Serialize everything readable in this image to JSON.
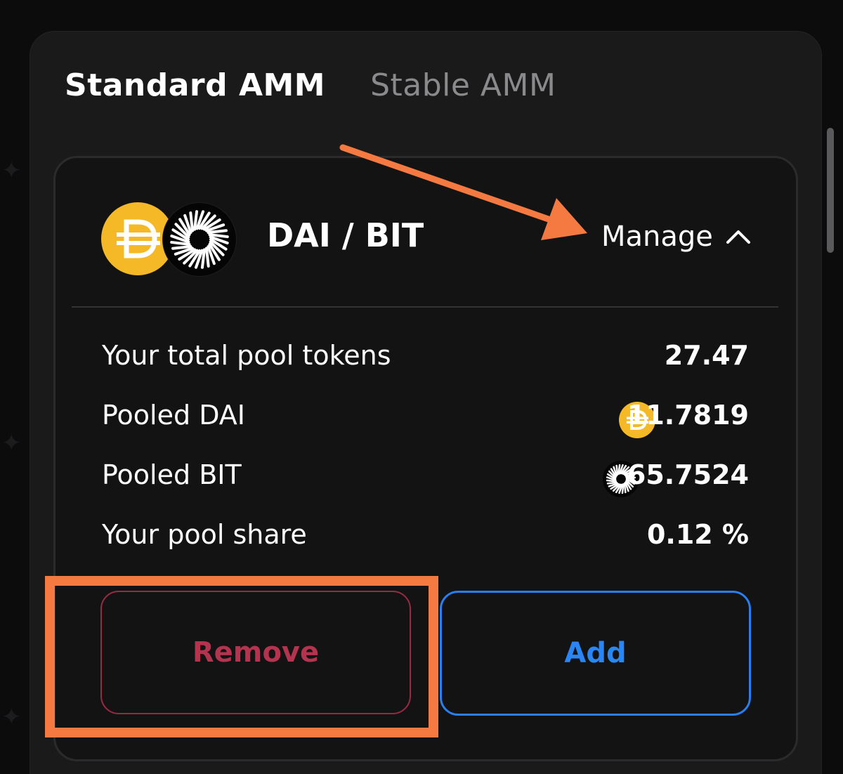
{
  "tabs": [
    {
      "label": "Standard AMM",
      "active": true
    },
    {
      "label": "Stable AMM",
      "active": false
    }
  ],
  "pair": {
    "title": "DAI / BIT",
    "token_a_icon": "dai-token-icon",
    "token_b_icon": "bit-token-icon"
  },
  "manage": {
    "label": "Manage",
    "icon": "chevron-up-icon"
  },
  "position": {
    "rows": [
      {
        "label": "Your total pool tokens",
        "value": "27.47"
      },
      {
        "label": "Pooled DAI",
        "value": "11.7819",
        "icon": "dai-token-icon"
      },
      {
        "label": "Pooled BIT",
        "value": "65.7524",
        "icon": "bit-token-icon"
      },
      {
        "label": "Your pool share",
        "value": "0.12 %"
      }
    ]
  },
  "actions": {
    "remove_label": "Remove",
    "add_label": "Add"
  },
  "colors": {
    "remove": "#b4334f",
    "add": "#2b86f5",
    "dai": "#f5b827",
    "annotation": "#f47a42"
  }
}
